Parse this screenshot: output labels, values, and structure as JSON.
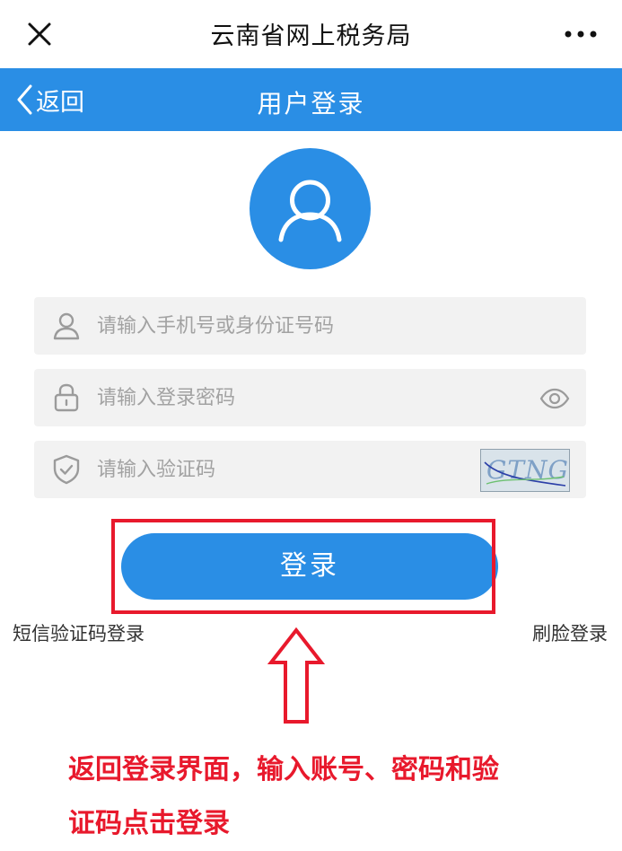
{
  "window": {
    "title": "云南省网上税务局",
    "close_icon": "close-icon",
    "more_icon": "more-icon"
  },
  "nav": {
    "back_label": "返回",
    "title": "用户登录"
  },
  "form": {
    "account": {
      "placeholder": "请输入手机号或身份证号码",
      "value": "",
      "icon": "user-icon"
    },
    "password": {
      "placeholder": "请输入登录密码",
      "value": "",
      "icon": "lock-icon",
      "toggle_icon": "eye-icon"
    },
    "captcha": {
      "placeholder": "请输入验证码",
      "value": "",
      "icon": "shield-icon",
      "image_text": "GTNG"
    },
    "login_label": "登录"
  },
  "links": {
    "sms_login": "短信验证码登录",
    "face_login": "刷脸登录"
  },
  "annotation": {
    "line1": "返回登录界面，输入账号、密码和验",
    "line2": "证码点击登录"
  },
  "colors": {
    "primary": "#2a8ee5",
    "annotation_red": "#e8192c",
    "field_bg": "#f2f2f2"
  }
}
